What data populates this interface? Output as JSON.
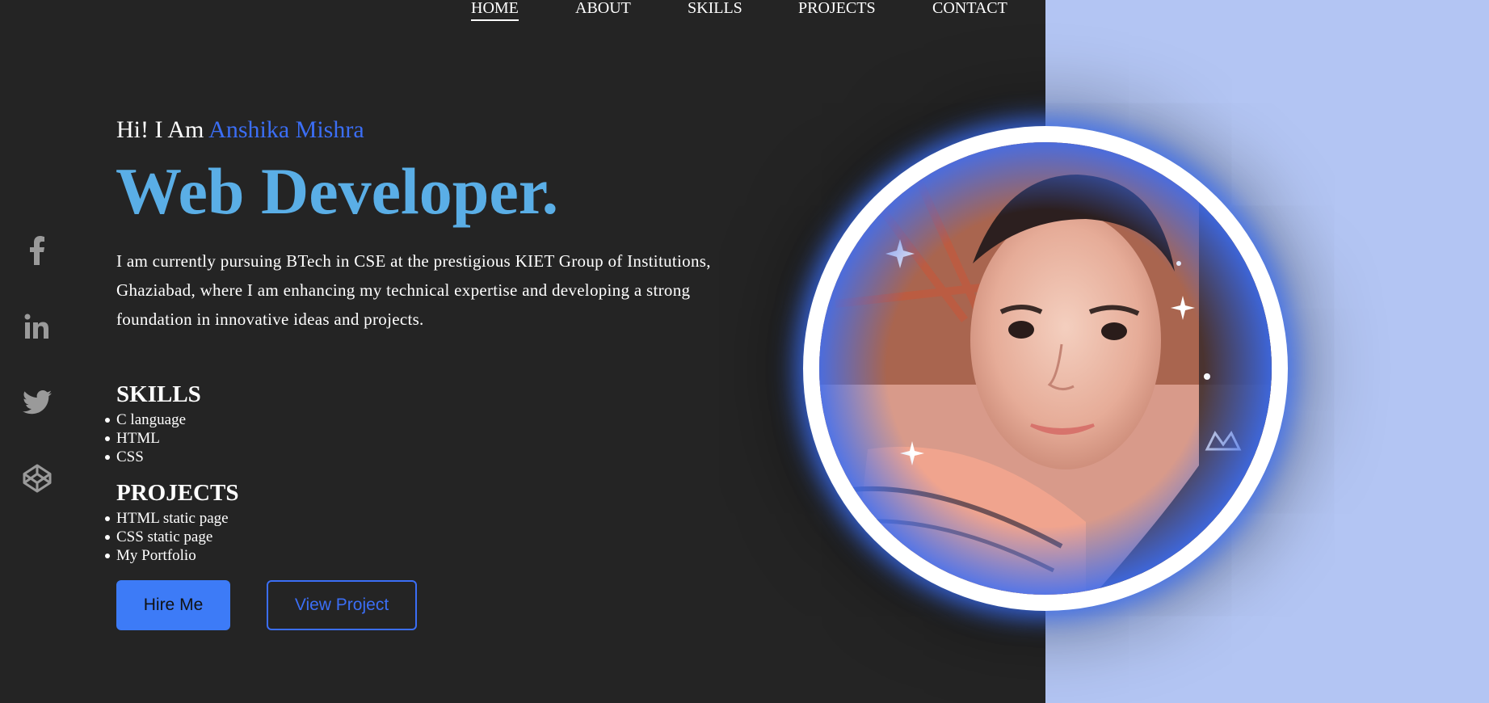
{
  "nav": {
    "items": [
      {
        "label": "HOME"
      },
      {
        "label": "ABOUT"
      },
      {
        "label": "SKILLS"
      },
      {
        "label": "PROJECTS"
      },
      {
        "label": "CONTACT"
      }
    ]
  },
  "social": {
    "icons": [
      "facebook-icon",
      "linkedin-icon",
      "twitter-icon",
      "codepen-icon"
    ]
  },
  "hero": {
    "greeting": "Hi! I Am ",
    "name": "Anshika Mishra",
    "role": "Web Developer.",
    "intro": "I am currently pursuing BTech in CSE at the prestigious KIET Group of Institutions, Ghaziabad, where I am enhancing my technical expertise and developing a strong foundation in innovative ideas and projects."
  },
  "skills": {
    "title": "SKILLS",
    "items": [
      "C language",
      "HTML",
      "CSS"
    ]
  },
  "projects": {
    "title": "PROJECTS",
    "items": [
      "HTML static page",
      "CSS static page",
      "My Portfolio"
    ]
  },
  "buttons": {
    "hire": "Hire Me",
    "view": "View Project"
  },
  "colors": {
    "background": "#242424",
    "accent": "#3b6ef5",
    "role": "#5aaee6",
    "panel": "#b3c5f3"
  }
}
